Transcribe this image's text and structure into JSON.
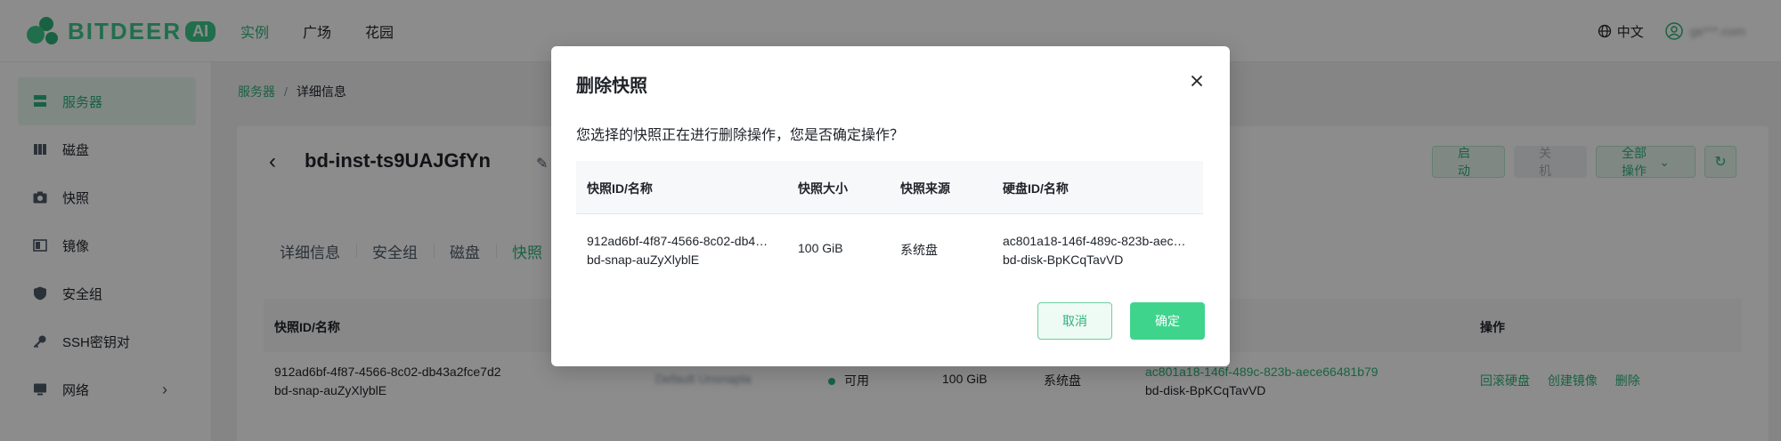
{
  "brand": {
    "name": "BITDEER",
    "badge": "AI",
    "accent": "#2db37a"
  },
  "nav": {
    "items": [
      "实例",
      "广场",
      "花园"
    ],
    "active_index": 0
  },
  "topright": {
    "language": "中文",
    "username": "ge***.com"
  },
  "sidebar": {
    "items": [
      {
        "label": "服务器",
        "icon": "server-icon",
        "active": true
      },
      {
        "label": "磁盘",
        "icon": "disk-icon"
      },
      {
        "label": "快照",
        "icon": "camera-icon"
      },
      {
        "label": "镜像",
        "icon": "image-icon"
      },
      {
        "label": "安全组",
        "icon": "shield-icon"
      },
      {
        "label": "SSH密钥对",
        "icon": "key-icon"
      },
      {
        "label": "网络",
        "icon": "network-icon",
        "has_children": true
      }
    ]
  },
  "breadcrumb": {
    "root": "服务器",
    "separator": "/",
    "current": "详细信息"
  },
  "instance": {
    "title": "bd-inst-ts9UAJGfYn"
  },
  "actions": {
    "start": "启动",
    "stop": "关机",
    "all": "全部操作"
  },
  "tabs": {
    "items": [
      "详细信息",
      "安全组",
      "磁盘",
      "快照"
    ],
    "active_index": 3
  },
  "snapshot_table": {
    "headers": {
      "id_name": "快照ID/名称",
      "actions": "操作"
    },
    "row": {
      "id": "912ad6bf-4f87-4566-8c02-db43a2fce7d2",
      "name": "bd-snap-auZyXlyblE",
      "description": "Default Unsnapla",
      "status": "可用",
      "size": "100 GiB",
      "source": "系统盘",
      "disk_id": "ac801a18-146f-489c-823b-aece66481b79",
      "disk_name": "bd-disk-BpKCqTavVD",
      "actions": [
        "回滚硬盘",
        "创建镜像",
        "删除"
      ]
    }
  },
  "modal": {
    "title": "删除快照",
    "message": "您选择的快照正在进行删除操作，您是否确定操作？",
    "headers": {
      "id_name": "快照ID/名称",
      "size": "快照大小",
      "source": "快照来源",
      "disk": "硬盘ID/名称"
    },
    "row": {
      "id": "912ad6bf-4f87-4566-8c02-db43a2fce7d2",
      "name": "bd-snap-auZyXlyblE",
      "size": "100 GiB",
      "source": "系统盘",
      "disk_id": "ac801a18-146f-489c-823b-aece66481b79",
      "disk_name": "bd-disk-BpKCqTavVD"
    },
    "cancel": "取消",
    "confirm": "确定"
  }
}
